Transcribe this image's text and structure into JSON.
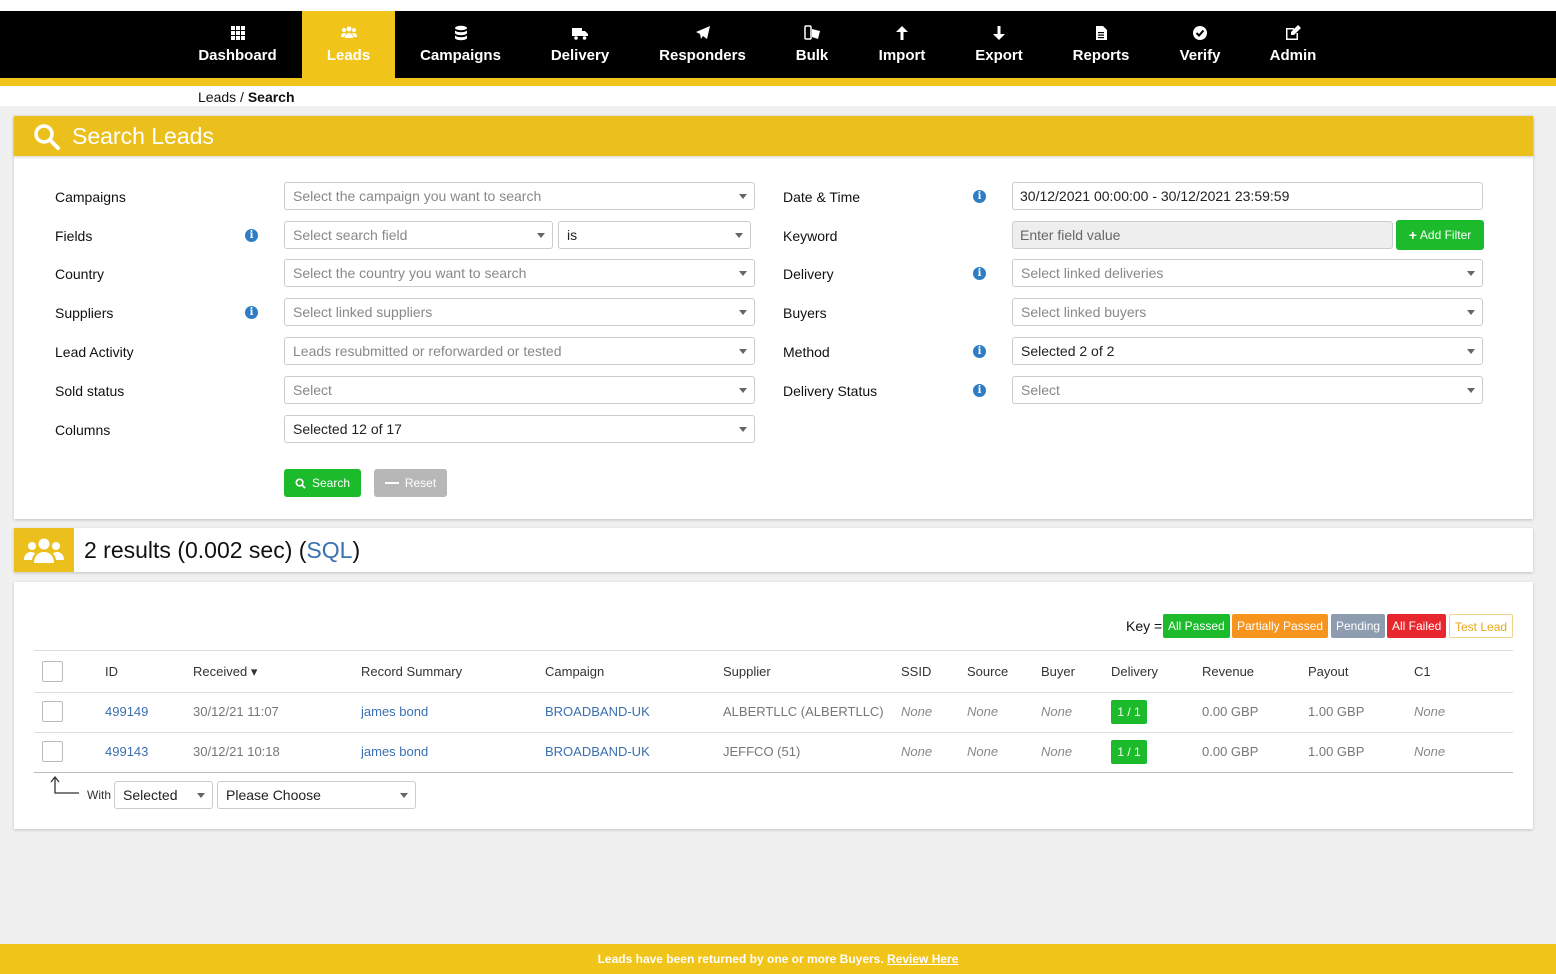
{
  "nav": {
    "items": [
      {
        "label": "Dashboard",
        "icon": "grid-icon"
      },
      {
        "label": "Leads",
        "icon": "users-icon"
      },
      {
        "label": "Campaigns",
        "icon": "database-icon"
      },
      {
        "label": "Delivery",
        "icon": "truck-icon"
      },
      {
        "label": "Responders",
        "icon": "paper-plane-icon"
      },
      {
        "label": "Bulk",
        "icon": "devices-icon"
      },
      {
        "label": "Import",
        "icon": "arrow-up-icon"
      },
      {
        "label": "Export",
        "icon": "arrow-down-icon"
      },
      {
        "label": "Reports",
        "icon": "file-icon"
      },
      {
        "label": "Verify",
        "icon": "check-circle-icon"
      },
      {
        "label": "Admin",
        "icon": "edit-icon"
      }
    ],
    "active": "Leads",
    "accent_color": "#f0c419"
  },
  "breadcrumb": {
    "parent": "Leads",
    "separator": " / ",
    "current": "Search"
  },
  "search_panel": {
    "title": "Search Leads",
    "left": {
      "campaigns": {
        "label": "Campaigns",
        "placeholder": "Select the campaign you want to search"
      },
      "fields": {
        "label": "Fields",
        "placeholder": "Select search field",
        "operator": "is"
      },
      "country": {
        "label": "Country",
        "placeholder": "Select the country you want to search"
      },
      "suppliers": {
        "label": "Suppliers",
        "placeholder": "Select linked suppliers"
      },
      "lead_activity": {
        "label": "Lead Activity",
        "placeholder": "Leads resubmitted or reforwarded or tested"
      },
      "sold_status": {
        "label": "Sold status",
        "placeholder": "Select"
      },
      "columns": {
        "label": "Columns",
        "value": "Selected 12 of 17"
      }
    },
    "right": {
      "date_time": {
        "label": "Date & Time",
        "value": "30/12/2021 00:00:00 - 30/12/2021 23:59:59"
      },
      "keyword": {
        "label": "Keyword",
        "placeholder": "Enter field value",
        "add_filter": "Add Filter"
      },
      "delivery": {
        "label": "Delivery",
        "placeholder": "Select linked deliveries"
      },
      "buyers": {
        "label": "Buyers",
        "placeholder": "Select linked buyers"
      },
      "method": {
        "label": "Method",
        "value": "Selected 2 of 2"
      },
      "delivery_status": {
        "label": "Delivery Status",
        "placeholder": "Select"
      }
    },
    "search_button": "Search",
    "reset_button": "Reset"
  },
  "results": {
    "count_text": "2 results (0.002 sec) (",
    "sql_link": "SQL",
    "close_paren": ")"
  },
  "key": {
    "label": "Key =",
    "items": [
      {
        "label": "All Passed",
        "color": "#1bbb2b"
      },
      {
        "label": "Partially Passed",
        "color": "#f7941d"
      },
      {
        "label": "Pending",
        "color": "#8e9cb0"
      },
      {
        "label": "All Failed",
        "color": "#e8262d"
      },
      {
        "label": "Test Lead",
        "color": "#ffffff"
      }
    ]
  },
  "table": {
    "headers": [
      "ID",
      "Received",
      "Record Summary",
      "Campaign",
      "Supplier",
      "SSID",
      "Source",
      "Buyer",
      "Delivery",
      "Revenue",
      "Payout",
      "C1"
    ],
    "sort_indicator": "▾",
    "rows": [
      {
        "id": "499149",
        "received": "30/12/21 11:07",
        "summary": "james bond",
        "campaign": "BROADBAND-UK",
        "supplier": "ALBERTLLC (ALBERTLLC)",
        "ssid": "None",
        "source": "None",
        "buyer": "None",
        "delivery": "1 / 1",
        "revenue": "0.00 GBP",
        "payout": "1.00 GBP",
        "c1": "None"
      },
      {
        "id": "499143",
        "received": "30/12/21 10:18",
        "summary": "james bond",
        "campaign": "BROADBAND-UK",
        "supplier": "JEFFCO (51)",
        "ssid": "None",
        "source": "None",
        "buyer": "None",
        "delivery": "1 / 1",
        "revenue": "0.00 GBP",
        "payout": "1.00 GBP",
        "c1": "None"
      }
    ]
  },
  "bulk_actions": {
    "with_label": "With",
    "selected": "Selected",
    "action": "Please Choose"
  },
  "footer": {
    "message": "Leads have been returned by one or more Buyers.",
    "link": "Review Here"
  }
}
